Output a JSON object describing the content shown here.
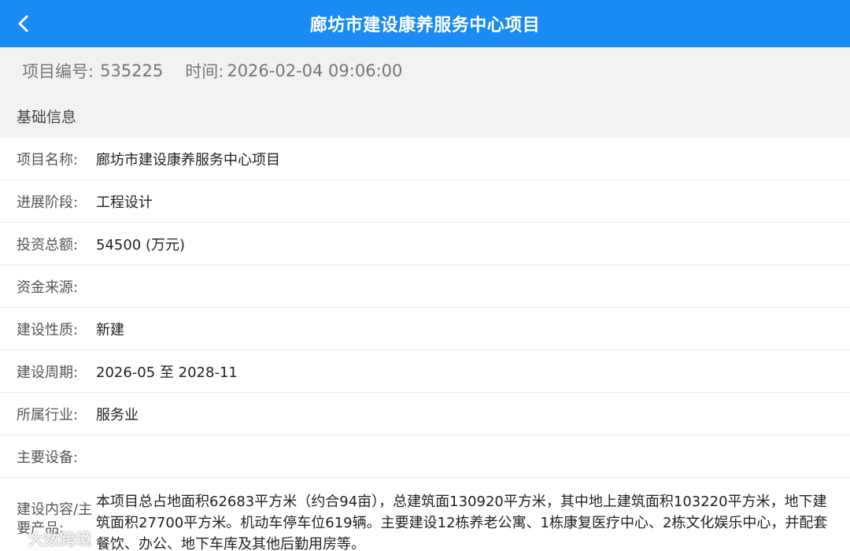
{
  "header": {
    "title": "廊坊市建设康养服务中心项目",
    "back_icon": "chevron-left-icon",
    "background": "#1a8bf2"
  },
  "meta": {
    "project_no_label": "项目编号:",
    "project_no": "535225",
    "time_label": "时间:",
    "time": "2026-02-04 09:06:00"
  },
  "section": {
    "title": "基础信息"
  },
  "fields": [
    {
      "label": "项目名称:",
      "value": "廊坊市建设康养服务中心项目"
    },
    {
      "label": "进展阶段:",
      "value": "工程设计"
    },
    {
      "label": "投资总额:",
      "value": "54500 (万元)"
    },
    {
      "label": "资金来源:",
      "value": ""
    },
    {
      "label": "建设性质:",
      "value": "新建"
    },
    {
      "label": "建设周期:",
      "value": "2026-05 至 2028-11"
    },
    {
      "label": "所属行业:",
      "value": "服务业"
    },
    {
      "label": "主要设备:",
      "value": ""
    },
    {
      "label": "建设内容/主要产品:",
      "value": "本项目总占地面积62683平方米（约合94亩），总建筑面130920平方米，其中地上建筑面积103220平方米，地下建筑面积27700平方米。机动车停车位619辆。主要建设12栋养老公寓、1栋康复医疗中心、2栋文化娱乐中心，并配套餐饮、办公、地下车库及其他后勤用房等。"
    }
  ],
  "watermark": {
    "text": "大数跨境"
  }
}
